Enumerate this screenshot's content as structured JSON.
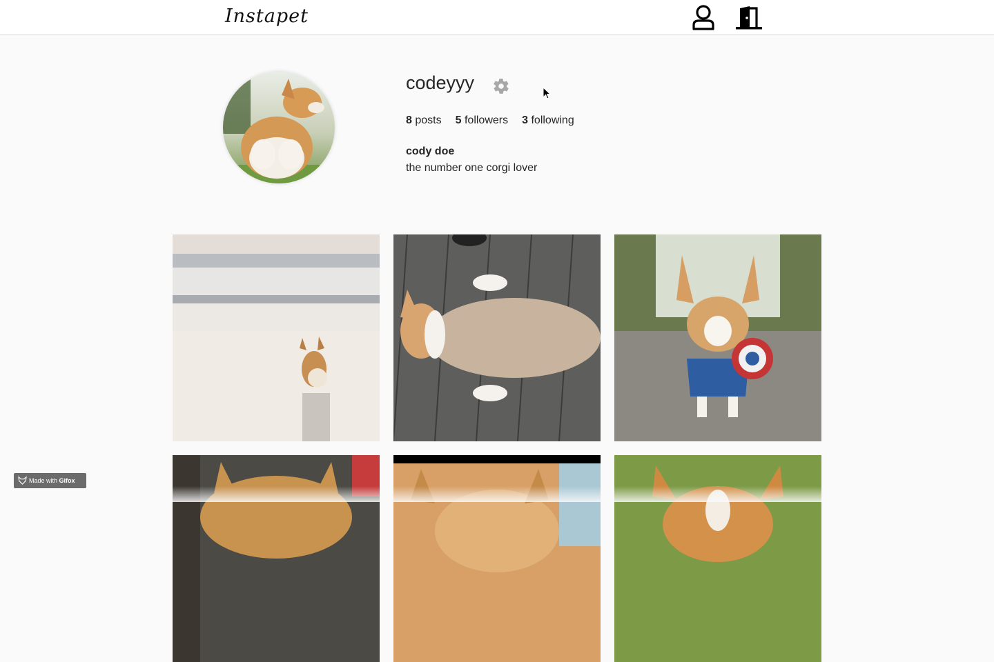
{
  "header": {
    "logo_text": "Instapet",
    "icons": [
      "user-icon",
      "door-exit-icon"
    ]
  },
  "profile": {
    "username": "codeyyy",
    "stats": {
      "posts_count": "8",
      "posts_label": "posts",
      "followers_count": "5",
      "followers_label": "followers",
      "following_count": "3",
      "following_label": "following"
    },
    "full_name": "cody doe",
    "bio": "the number one corgi lover",
    "settings_icon": "gear-icon"
  },
  "posts": [
    {
      "id": "post-1"
    },
    {
      "id": "post-2"
    },
    {
      "id": "post-3"
    },
    {
      "id": "post-4"
    },
    {
      "id": "post-5"
    },
    {
      "id": "post-6"
    }
  ],
  "watermark": {
    "prefix": "Made with ",
    "brand": "Gifox"
  },
  "colors": {
    "background": "#fafafa",
    "text": "#262626",
    "border": "#dbdbdb",
    "gear": "#a8a8a8"
  }
}
